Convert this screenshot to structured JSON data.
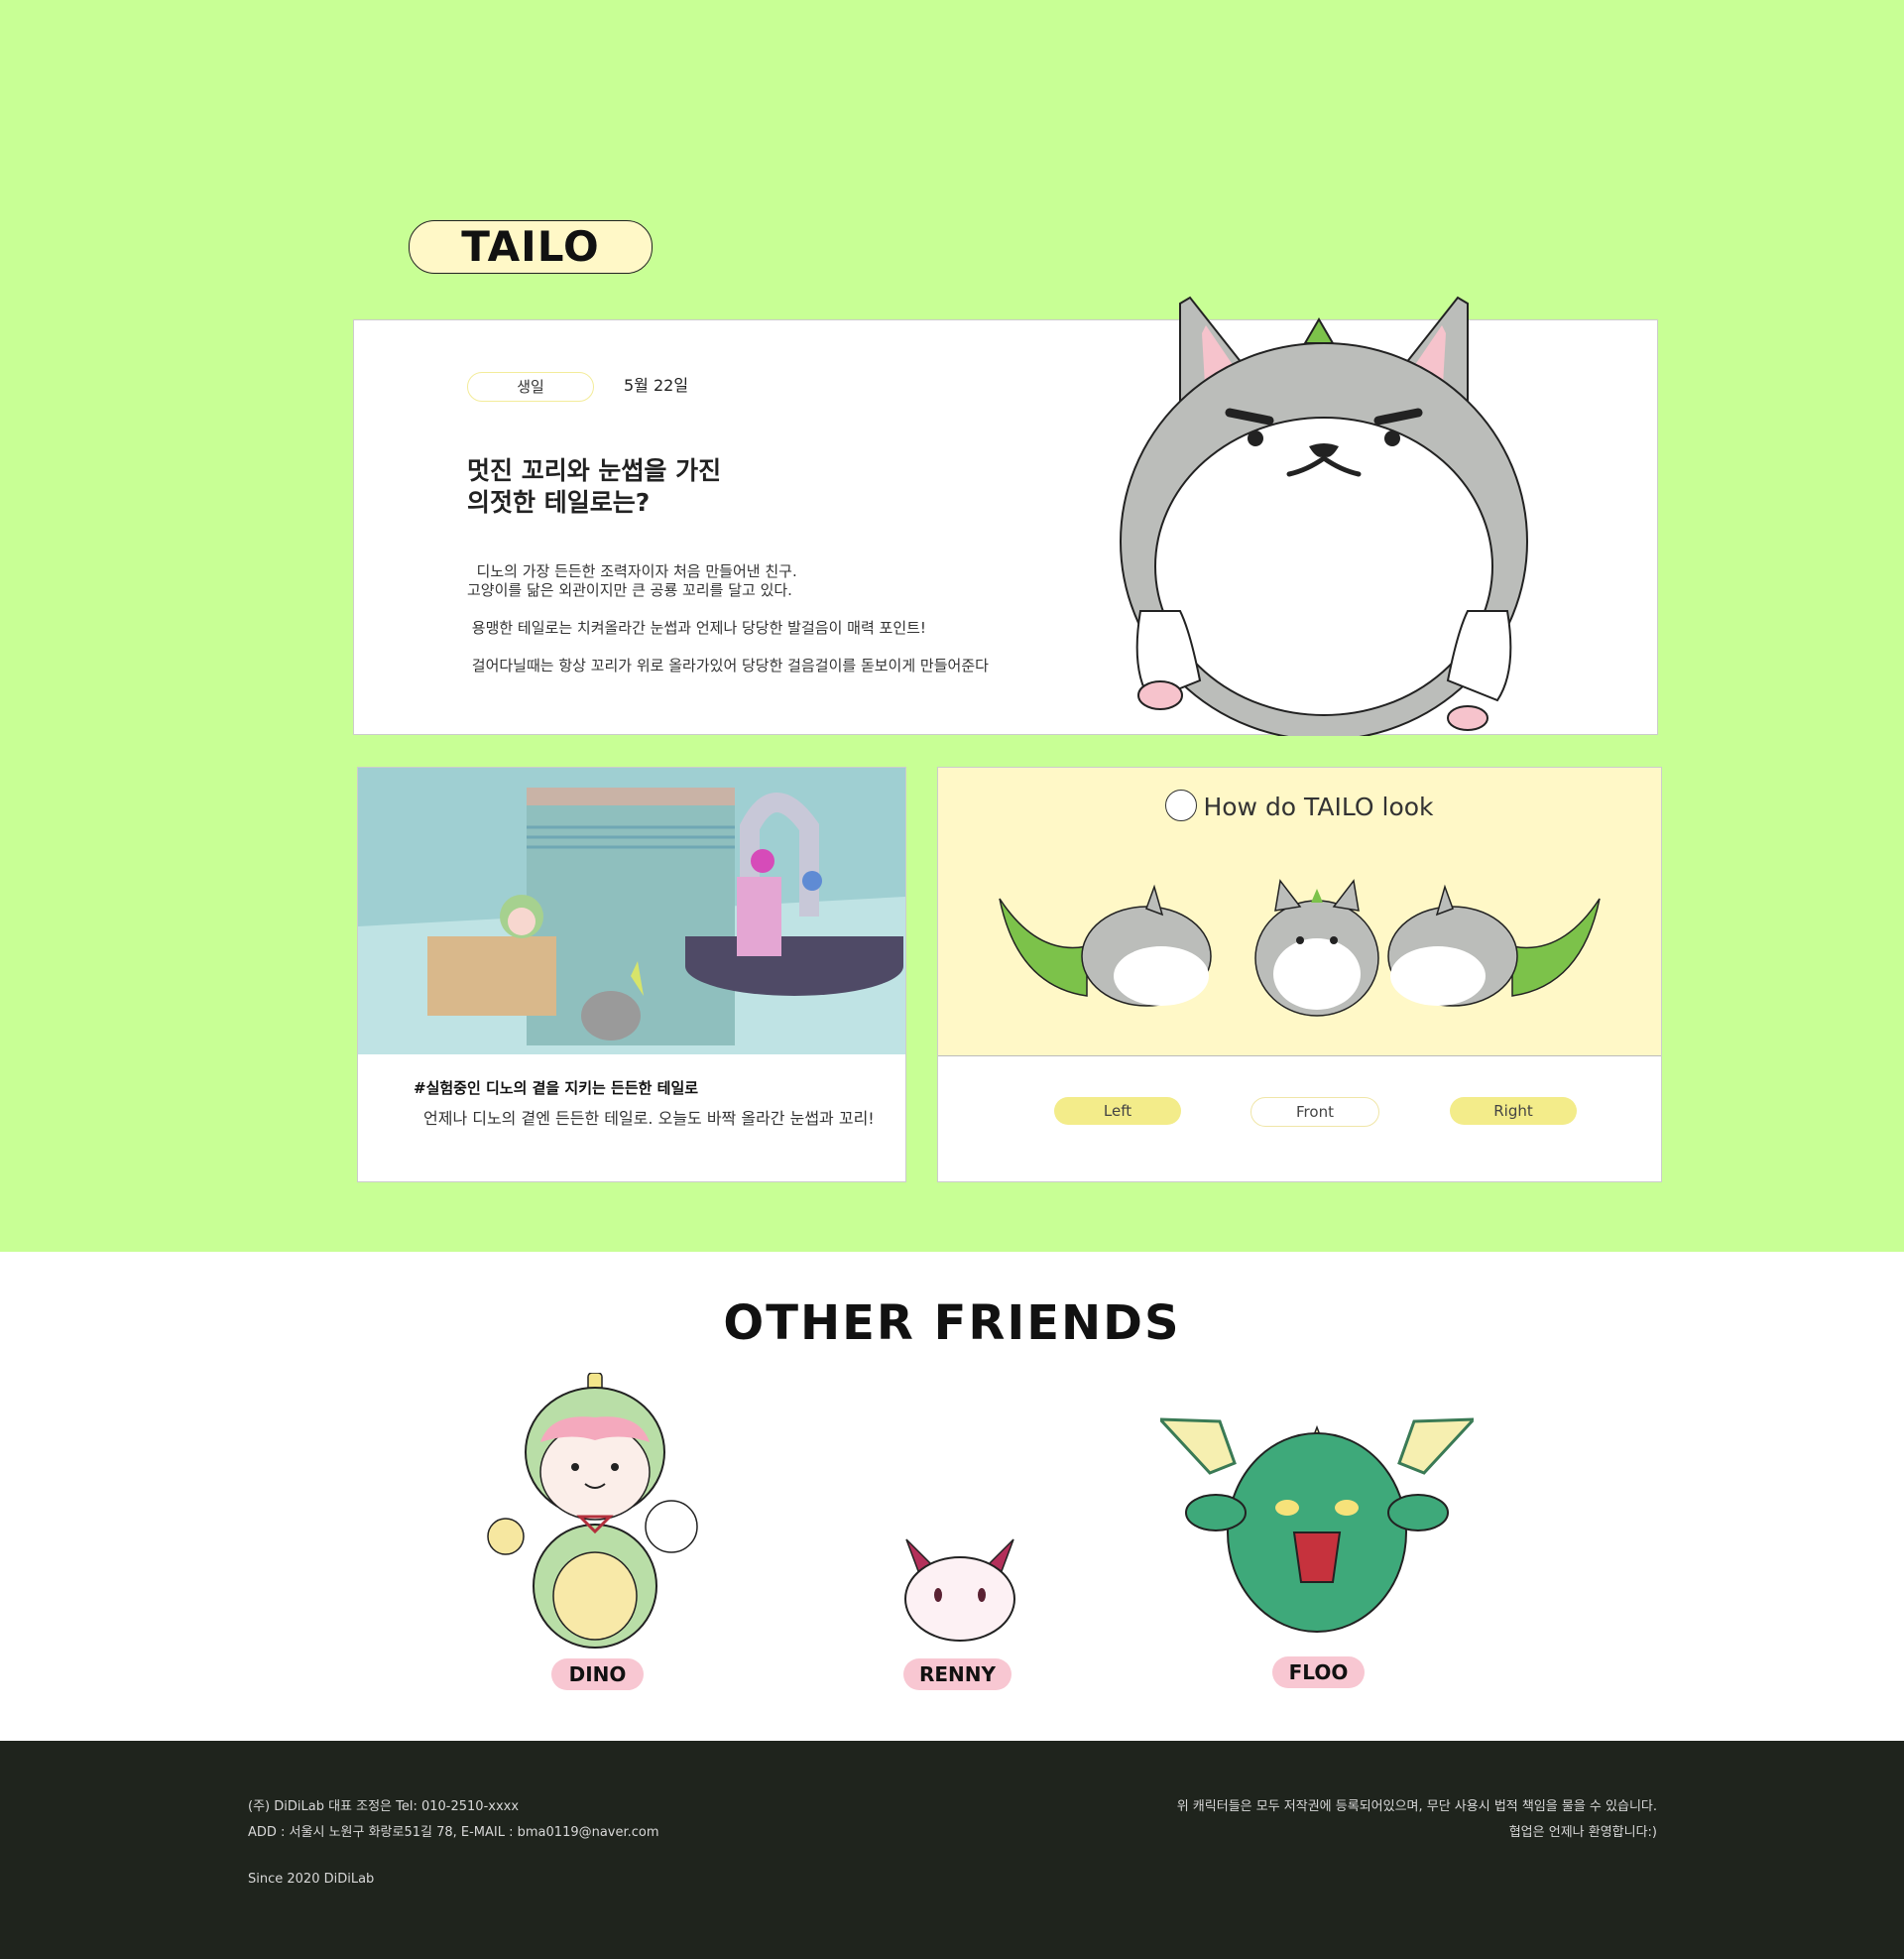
{
  "hero": {
    "title": "TAILO",
    "birthday_label": "생일",
    "birthday_value": "5월 22일",
    "headline_1": "멋진 꼬리와 눈썹을 가진",
    "headline_2": "의젓한 테일로는?",
    "desc_1": "  디노의 가장 든든한 조력자이자 처음 만들어낸 친구.",
    "desc_2": "고양이를 닮은 외관이지만 큰 공룡 꼬리를 달고 있다.",
    "desc_3": " 용맹한 테일로는 치켜올라간 눈썹과 언제나 당당한 발걸음이 매력 포인트!",
    "desc_4": " 걸어다닐때는 항상 꼬리가 위로 올라가있어 당당한 걸음걸이를 돋보이게 만들어준다"
  },
  "photo_card": {
    "caption_title": "#실험중인 디노의 곁을 지키는 든든한 테일로",
    "caption_body": "언제나 디노의 곁엔 든든한 테일로. 오늘도 바짝 올라간 눈썹과 꼬리!"
  },
  "look_card": {
    "title": "How do TAILO look",
    "buttons": [
      "Left",
      "Front",
      "Right"
    ],
    "selected": [
      "Left",
      "Right"
    ]
  },
  "friends": {
    "title": "OTHER FRIENDS",
    "names": [
      "DINO",
      "RENNY",
      "FLOO"
    ]
  },
  "footer": {
    "line_1": "(주) DiDiLab 대표 조정은 Tel: 010-2510-xxxx",
    "line_2": "ADD : 서울시 노원구 화랑로51길 78, E-MAIL : bma0119@naver.com",
    "since": "Since 2020 DiDiLab",
    "notice_1": "위 캐릭터들은 모두 저작권에 등록되어있으며, 무단 사용시 법적 책임을 물을 수 있습니다.",
    "notice_2": "협업은 언제나 환영합니다:)"
  },
  "colors": {
    "hero_bg": "#c8ff95",
    "pill_yellow": "#fff8c7",
    "pill_pink": "#f8c7d2",
    "footer_bg": "#1f241d"
  }
}
